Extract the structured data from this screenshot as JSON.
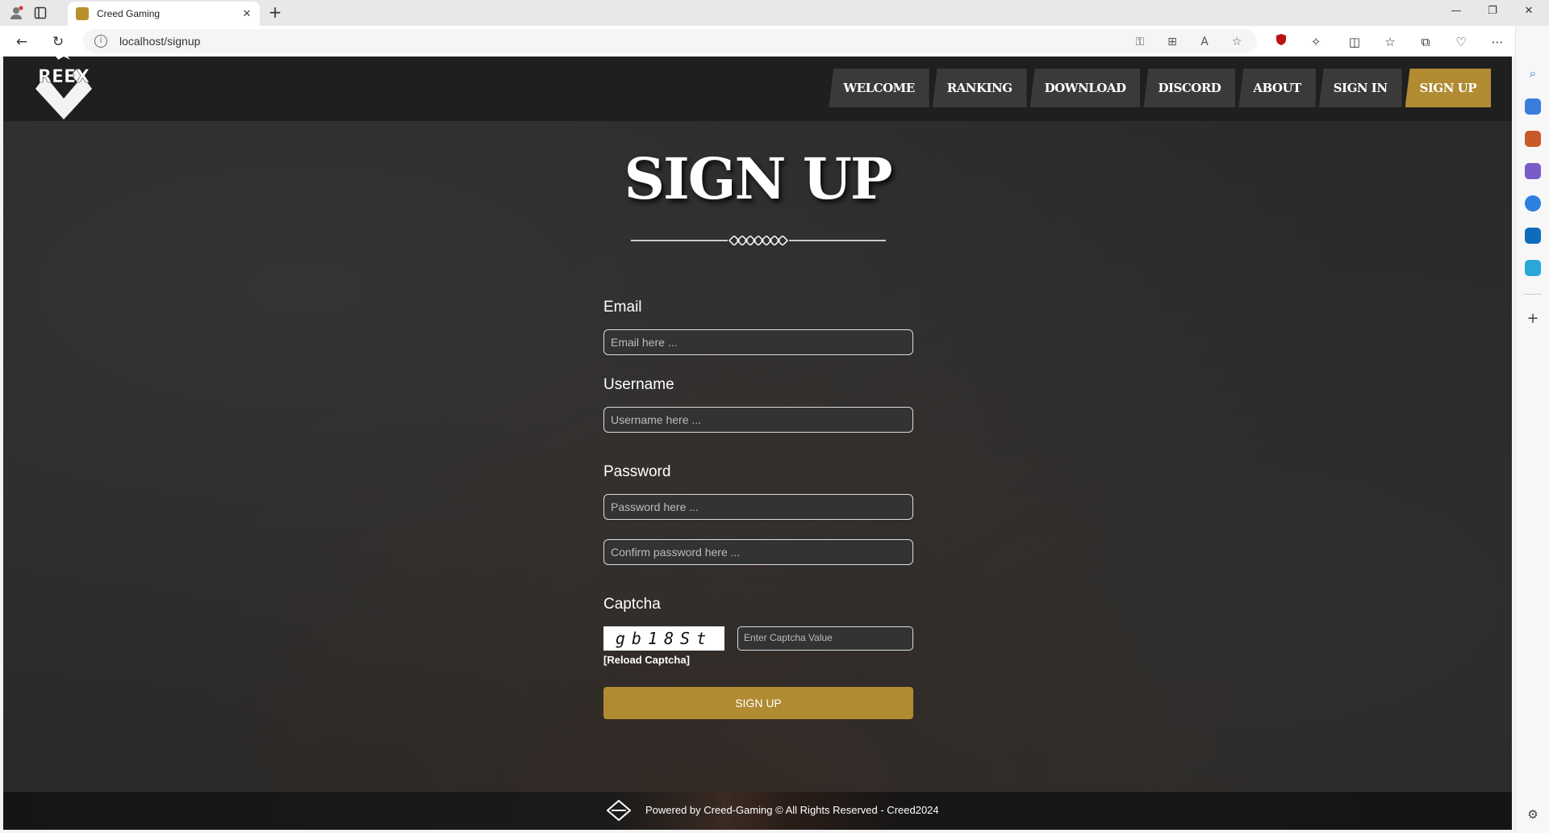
{
  "browser": {
    "tab_title": "Creed Gaming",
    "url": "localhost/signup"
  },
  "site": {
    "logo_text": "REEX",
    "menu": [
      {
        "label": "Welcome"
      },
      {
        "label": "Ranking"
      },
      {
        "label": "Download"
      },
      {
        "label": "Discord"
      },
      {
        "label": "About"
      },
      {
        "label": "Sign In"
      },
      {
        "label": "Sign Up"
      }
    ],
    "accent_color": "#b08b32"
  },
  "page": {
    "title": "SIGN UP",
    "email_label": "Email",
    "email_placeholder": "Email here ...",
    "username_label": "Username",
    "username_placeholder": "Username here ...",
    "password_label": "Password",
    "password_placeholder": "Password here ...",
    "confirm_placeholder": "Confirm password here ...",
    "captcha_label": "Captcha",
    "captcha_code": "gb18St",
    "captcha_placeholder": "Enter Captcha Value",
    "reload_label": "[Reload Captcha]",
    "submit_label": "SIGN UP"
  },
  "footer": {
    "text": "Powered by Creed-Gaming © All Rights Reserved - Creed2024"
  }
}
